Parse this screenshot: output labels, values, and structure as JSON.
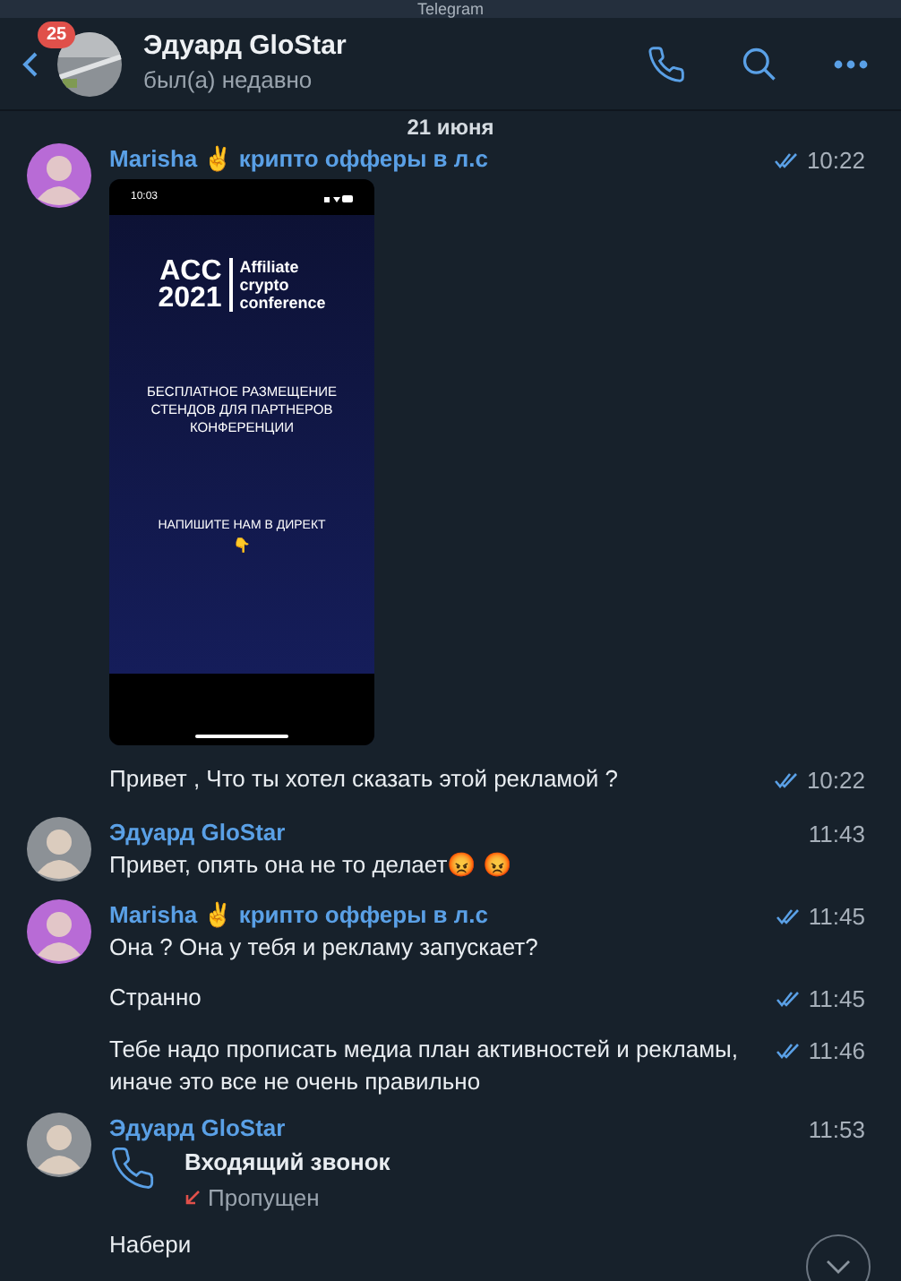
{
  "window": {
    "title": "Telegram"
  },
  "header": {
    "unread_badge": "25",
    "name": "Эдуард GloStar",
    "status": "был(а) недавно"
  },
  "date": "21 июня",
  "messages": [
    {
      "kind": "image",
      "sender": "Marisha ✌ крипто офферы в л.с",
      "color": "#b86bd6",
      "time": "10:22",
      "read": true,
      "image": {
        "status_time": "10:03",
        "logo_acc": "ACC",
        "logo_year": "2021",
        "tagline": [
          "Affiliate",
          "crypto",
          "conference"
        ],
        "headline": "БЕСПЛАТНОЕ РАЗМЕЩЕНИЕ СТЕНДОВ ДЛЯ ПАРТНЕРОВ КОНФЕРЕНЦИИ",
        "cta": "НАПИШИТЕ НАМ В ДИРЕКТ",
        "cta_emoji": "👇"
      }
    },
    {
      "kind": "text",
      "text": "Привет , Что ты хотел сказать этой рекламой ?",
      "time": "10:22",
      "read": true
    },
    {
      "kind": "text",
      "sender": "Эдуард GloStar",
      "color": "#8c9196",
      "text": "Привет, опять она не то делает😡 😡",
      "time": "11:43",
      "read": false
    },
    {
      "kind": "text",
      "sender": "Marisha ✌ крипто офферы в л.с",
      "color": "#b86bd6",
      "text": "Она ? Она у тебя и рекламу запускает?",
      "time": "11:45",
      "read": true
    },
    {
      "kind": "text",
      "text": "Странно",
      "time": "11:45",
      "read": true
    },
    {
      "kind": "text",
      "text": "Тебе надо прописать медиа план активностей и рекламы, иначе это все не очень правильно",
      "time": "11:46",
      "read": true
    },
    {
      "kind": "call",
      "sender": "Эдуард GloStar",
      "color": "#8c9196",
      "title": "Входящий звонок",
      "status": "Пропущен",
      "time": "11:53",
      "read": false
    },
    {
      "kind": "text",
      "text": "Набери",
      "read": false
    }
  ]
}
